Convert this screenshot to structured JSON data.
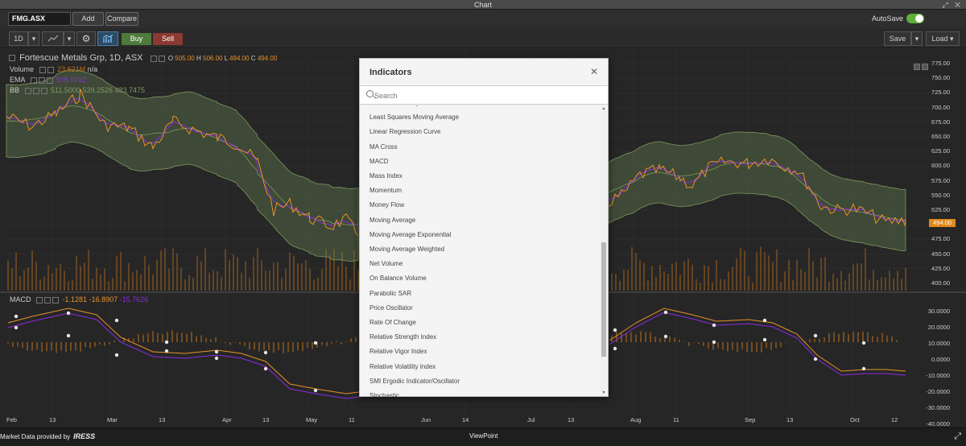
{
  "window": {
    "title": "Chart"
  },
  "toolbar": {
    "symbol": "FMG.ASX",
    "add_label": "Add",
    "compare_label": "Compare",
    "autosave_label": "AutoSave",
    "autosave_on": true,
    "interval_label": "1D",
    "buy_label": "Buy",
    "sell_label": "Sell",
    "save_label": "Save",
    "load_label": "Load"
  },
  "legend": {
    "title": "Fortescue Metals Grp, 1D, ASX",
    "o_label": "O",
    "o_value": "505.00",
    "h_label": "H",
    "h_value": "506.00",
    "l_label": "L",
    "l_value": "494.00",
    "c_label": "C",
    "c_value": "494.00",
    "volume_label": "Volume",
    "volume_value": "23.621M",
    "volume_na": "n/a",
    "ema_label": "EMA",
    "ema_value": "505.5022",
    "bb_label": "BB",
    "bb_values": "511.5000  539.2526  483.7475",
    "macd_label": "MACD",
    "macd_v1": "-1.1281",
    "macd_v2": "-16.8907",
    "macd_v3": "-15.7626"
  },
  "price_axis": [
    "775.00",
    "750.00",
    "725.00",
    "700.00",
    "675.00",
    "650.00",
    "625.00",
    "600.00",
    "575.00",
    "550.00",
    "525.00",
    "500.00",
    "475.00",
    "450.00",
    "425.00",
    "400.00"
  ],
  "current_price": "494.00",
  "macd_axis": [
    "30.0000",
    "20.0000",
    "10.0000",
    "0.0000",
    "-10.0000",
    "-20.0000",
    "-30.0000",
    "-40.0000"
  ],
  "x_axis": [
    "Feb",
    "13",
    "Mar",
    "13",
    "Apr",
    "13",
    "May",
    "11",
    "Jun",
    "14",
    "Jul",
    "13",
    "Aug",
    "11",
    "Sep",
    "13",
    "Oct",
    "12"
  ],
  "colors": {
    "price": "#e8912a",
    "ema": "#8a2be2",
    "bb": "#7d9a5d",
    "volume": "#c0711e",
    "modal_bg": "#f4f4f4"
  },
  "modal": {
    "title": "Indicators",
    "search_placeholder": "Search",
    "items": [
      "Know Sure Thing",
      "Least Squares Moving Average",
      "Linear Regression Curve",
      "MA Cross",
      "MACD",
      "Mass Index",
      "Momentum",
      "Money Flow",
      "Moving Average",
      "Moving Average Exponential",
      "Moving Average Weighted",
      "Net Volume",
      "On Balance Volume",
      "Parabolic SAR",
      "Price Oscillator",
      "Rate Of Change",
      "Relative Strength Index",
      "Relative Vigor Index",
      "Relative Volatility Index",
      "SMI Ergodic Indicator/Oscillator",
      "Stochastic"
    ]
  },
  "status": {
    "provider_text": "Market Data provided by",
    "provider_brand": "IRESS",
    "center": "ViewPoint"
  }
}
